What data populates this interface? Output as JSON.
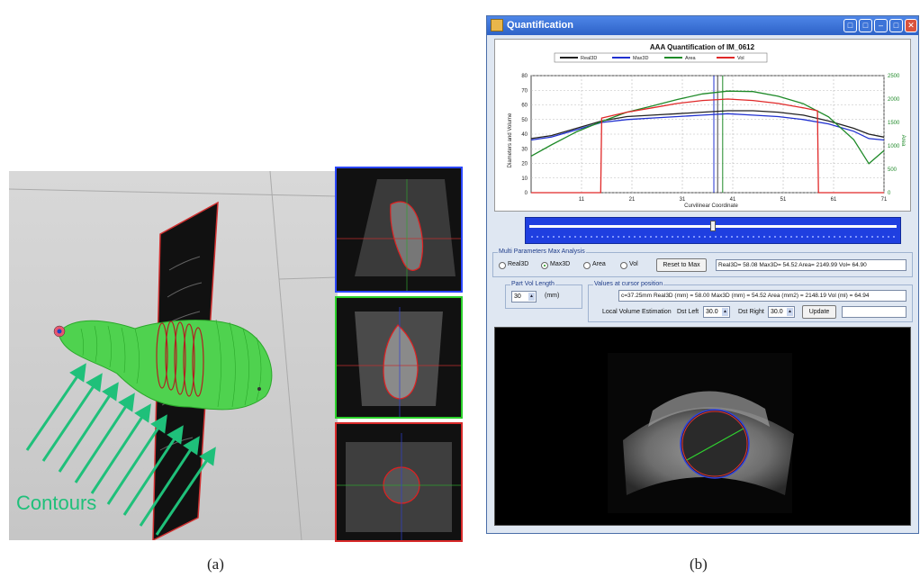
{
  "panel_a": {
    "label": "Contours",
    "caption": "(a)"
  },
  "panel_b": {
    "caption": "(b)",
    "window": {
      "title": "Quantification",
      "icons": [
        "restore-icon",
        "restore-icon",
        "minimize-icon",
        "maximize-icon",
        "close-icon"
      ]
    },
    "chart_data": {
      "type": "line",
      "title": "AAA Quantification of IM_0612",
      "xlabel": "Curvilinear Coordinate",
      "ylabel": "Diameters and Volume",
      "y2label": "Area",
      "x_ticks": [
        11,
        21,
        31,
        41,
        51,
        61,
        71
      ],
      "y_ticks": [
        0,
        10,
        20,
        30,
        40,
        50,
        60,
        70,
        80
      ],
      "y2_ticks": [
        0,
        500,
        1000,
        1500,
        2000,
        2500
      ],
      "xlim": [
        1,
        71
      ],
      "ylim": [
        0,
        80
      ],
      "y2lim": [
        0,
        2500
      ],
      "grid": true,
      "legend_position": "top",
      "cursor_x": [
        37.25,
        38,
        39
      ],
      "series": [
        {
          "name": "Real3D",
          "color": "#222222",
          "axis": "left",
          "x": [
            1,
            5,
            10,
            15,
            20,
            25,
            30,
            35,
            40,
            45,
            50,
            55,
            60,
            65,
            68,
            71
          ],
          "y": [
            37,
            39,
            44,
            49,
            52,
            53,
            54,
            55,
            56,
            56,
            55,
            53,
            49,
            44,
            40,
            38
          ]
        },
        {
          "name": "Max3D",
          "color": "#2030d0",
          "axis": "left",
          "x": [
            1,
            5,
            10,
            15,
            20,
            25,
            30,
            35,
            40,
            45,
            50,
            55,
            60,
            65,
            68,
            71
          ],
          "y": [
            36,
            38,
            43,
            48,
            50,
            51,
            52,
            53,
            54,
            53,
            52,
            50,
            47,
            42,
            37,
            36
          ]
        },
        {
          "name": "Area",
          "color": "#1e8a28",
          "axis": "right",
          "x": [
            1,
            5,
            10,
            15,
            20,
            25,
            30,
            35,
            40,
            45,
            50,
            55,
            60,
            65,
            68,
            71
          ],
          "y": [
            780,
            1020,
            1300,
            1520,
            1720,
            1850,
            1990,
            2110,
            2170,
            2160,
            2060,
            1900,
            1620,
            1130,
            620,
            900
          ]
        },
        {
          "name": "Vol",
          "color": "#e02828",
          "axis": "left",
          "x": [
            1,
            10,
            14.8,
            15,
            20,
            25,
            30,
            35,
            40,
            45,
            50,
            55,
            57.8,
            58,
            65,
            71
          ],
          "y": [
            0,
            0,
            0,
            51,
            55,
            58,
            61,
            63,
            64,
            63,
            61,
            58,
            56,
            0,
            0,
            0
          ]
        }
      ]
    },
    "slider": {
      "position": 0.5
    },
    "max_analysis": {
      "group_label": "Multi Parameters Max Analysis",
      "options": [
        "Real3D",
        "Max3D",
        "Area",
        "Vol"
      ],
      "selected": "Max3D",
      "reset_label": "Reset to Max",
      "readout": "Real3D= 58.08 Max3D= 54.52  Area= 2149.99  Vol= 64.90"
    },
    "part_vol": {
      "group_label": "Part Vol Length",
      "value": "30",
      "unit": "(mm)"
    },
    "cursor_values": {
      "group_label": "Values at cursor position",
      "readout": "c=37.25mm Real3D (mm) = 58.00  Max3D (mm) = 54.52  Area (mm2) = 2148.19  Vol (ml) = 64.94",
      "local_label": "Local Volume Estimation",
      "dst_left_label": "Dst Left",
      "dst_left_value": "30.0",
      "dst_right_label": "Dst Right",
      "dst_right_value": "30.0",
      "update_label": "Update",
      "result": ""
    }
  }
}
